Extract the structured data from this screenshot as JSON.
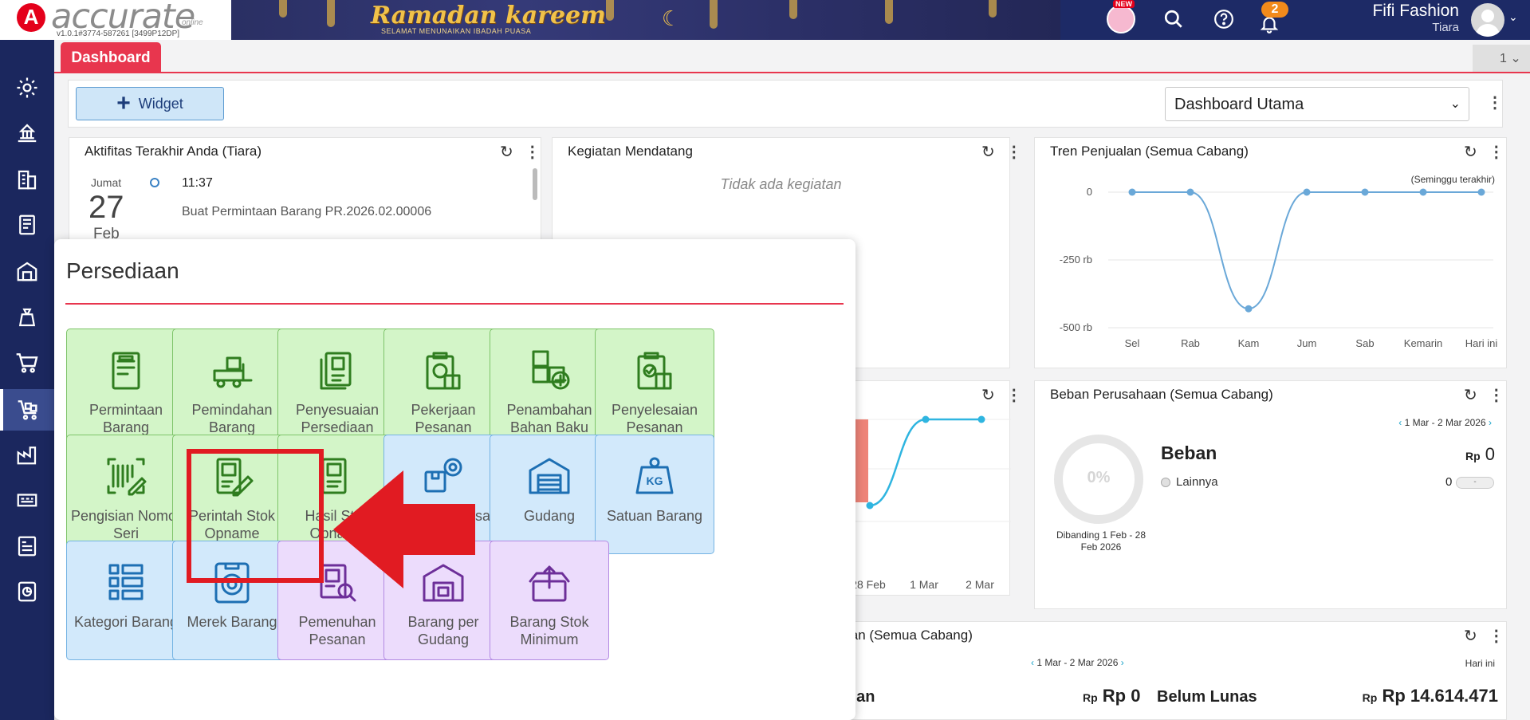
{
  "app": {
    "logo_letter": "A",
    "logo_name": "accurate",
    "logo_tag": "online",
    "version": "v1.0.1#3774-587261 [3499P12DP]"
  },
  "banner": {
    "title": "Ramadan kareem",
    "subtitle": "SELAMAT MENUNAIKAN IBADAH PUASA"
  },
  "header": {
    "new_badge": "NEW",
    "notif_count": "2",
    "company": "Fifi Fashion",
    "user": "Tiara"
  },
  "tabs": {
    "active": "Dashboard",
    "count": "1"
  },
  "toolbar": {
    "widget_label": "Widget",
    "dashboard_select": "Dashboard Utama"
  },
  "activity": {
    "title": "Aktifitas Terakhir Anda (Tiara)",
    "day": "Jumat",
    "date": "27",
    "month": "Feb",
    "time": "11:37",
    "desc": "Buat Permintaan Barang PR.2026.02.00006"
  },
  "upcoming": {
    "title": "Kegiatan Mendatang",
    "empty": "Tidak ada kegiatan"
  },
  "sales_trend": {
    "title": "Tren Penjualan (Semua Cabang)",
    "period": "(Seminggu terakhir)"
  },
  "chart_data": [
    {
      "type": "line",
      "title": "Tren Penjualan (Semua Cabang)",
      "categories": [
        "Sel",
        "Rab",
        "Kam",
        "Jum",
        "Sab",
        "Kemarin",
        "Hari ini"
      ],
      "series": [
        {
          "values": [
            0,
            0,
            -430,
            0,
            0,
            0,
            0
          ]
        }
      ],
      "yticks": [
        "0",
        "-250 rb",
        "-500 rb"
      ],
      "ylim": [
        -500,
        0
      ]
    },
    {
      "type": "line",
      "categories": [
        "28 Feb",
        "1 Mar",
        "2 Mar"
      ],
      "series": [
        {
          "values": [
            -10,
            100,
            100
          ]
        }
      ]
    }
  ],
  "middle_chart": {
    "xlabels": [
      "28 Feb",
      "1 Mar",
      "2 Mar"
    ]
  },
  "expense": {
    "title": "Beban Perusahaan (Semua Cabang)",
    "range": "1 Mar - 2 Mar 2026",
    "pct": "0%",
    "compare": "Dibanding 1 Feb - 28 Feb 2026",
    "label": "Beban",
    "currency": "Rp",
    "total": "0",
    "item_label": "Lainnya",
    "item_value": "0",
    "item_bar": "-"
  },
  "bottom": {
    "title_fragment": "ian (Semua Cabang)",
    "range": "1 Mar - 2 Mar 2026",
    "period": "Hari ini",
    "left_label": "lian",
    "left_prefix": "Rp",
    "left_value": "Rp 0",
    "right_label": "Belum Lunas",
    "right_prefix": "Rp",
    "right_value": "Rp 14.614.471"
  },
  "menu": {
    "title": "Persediaan",
    "tiles": [
      {
        "label": "Permintaan Barang",
        "icon": "document-icon",
        "color": "green"
      },
      {
        "label": "Pemindahan Barang",
        "icon": "forklift-icon",
        "color": "green"
      },
      {
        "label": "Penyesuaian Persediaan",
        "icon": "adjustment-icon",
        "color": "green"
      },
      {
        "label": "Pekerjaan Pesanan",
        "icon": "work-order-icon",
        "color": "green"
      },
      {
        "label": "Penambahan Bahan Baku",
        "icon": "add-material-icon",
        "color": "green"
      },
      {
        "label": "Penyelesaian Pesanan",
        "icon": "order-complete-icon",
        "color": "green"
      },
      {
        "label": "Pengisian Nomor Seri",
        "icon": "barcode-icon",
        "color": "green"
      },
      {
        "label": "Perintah Stok Opname",
        "icon": "stock-opname-order-icon",
        "color": "green"
      },
      {
        "label": "Hasil Stok Opname",
        "icon": "stock-opname-result-icon",
        "color": "green"
      },
      {
        "label": "Barang & Jasa",
        "icon": "box-gear-icon",
        "color": "blue"
      },
      {
        "label": "Gudang",
        "icon": "warehouse-icon",
        "color": "blue"
      },
      {
        "label": "Satuan Barang",
        "icon": "weight-kg-icon",
        "color": "blue"
      },
      {
        "label": "Kategori Barang",
        "icon": "category-icon",
        "color": "blue"
      },
      {
        "label": "Merek Barang",
        "icon": "brand-badge-icon",
        "color": "blue"
      },
      {
        "label": "Pemenuhan Pesanan",
        "icon": "order-search-icon",
        "color": "purple"
      },
      {
        "label": "Barang per Gudang",
        "icon": "warehouse-box-icon",
        "color": "purple"
      },
      {
        "label": "Barang Stok Minimum",
        "icon": "min-stock-icon",
        "color": "purple"
      }
    ]
  },
  "colors": {
    "accent": "#e8364e",
    "nav": "#1b275e",
    "highlight": "#e11b22"
  }
}
